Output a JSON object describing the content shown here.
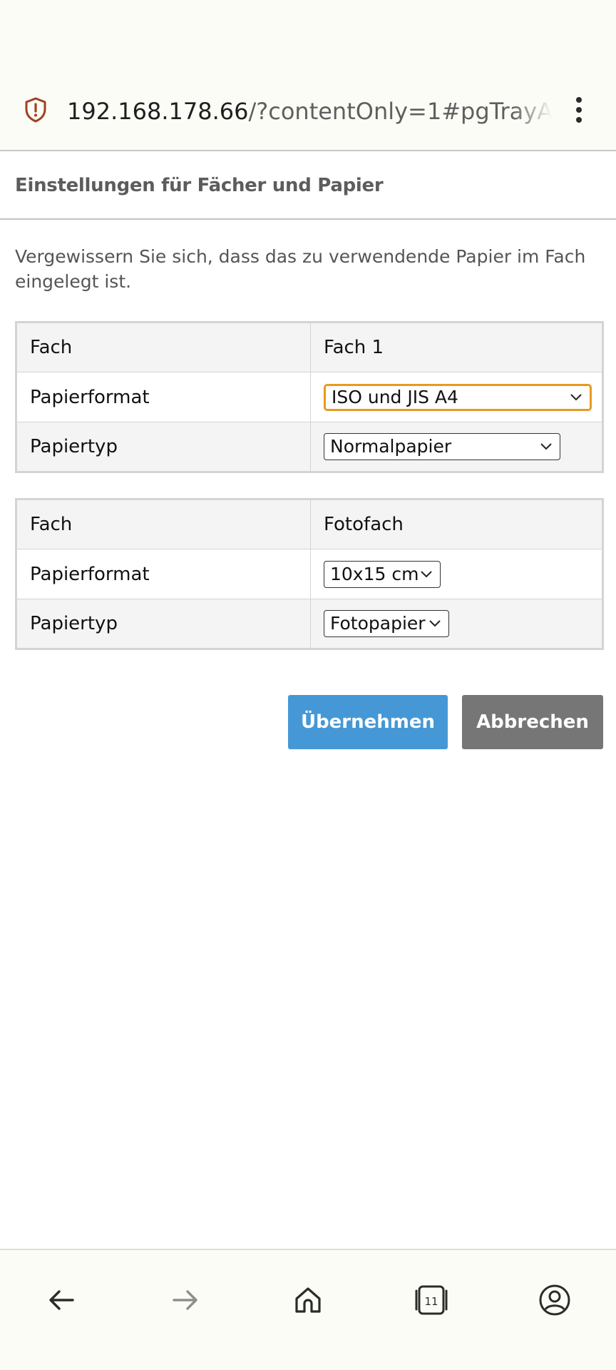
{
  "browser": {
    "url_host": "192.168.178.66",
    "url_path": "/?contentOnly=1#pgTrayAndPaper",
    "tab_count": "11"
  },
  "page": {
    "title": "Einstellungen für Fächer und Papier",
    "intro": "Vergewissern Sie sich, dass das zu verwendende Papier im Fach eingelegt ist."
  },
  "trays": [
    {
      "tray_label": "Fach",
      "tray_value": "Fach 1",
      "format_label": "Papierformat",
      "format_value": "ISO und JIS A4",
      "type_label": "Papiertyp",
      "type_value": "Normalpapier"
    },
    {
      "tray_label": "Fach",
      "tray_value": "Fotofach",
      "format_label": "Papierformat",
      "format_value": "10x15 cm",
      "type_label": "Papiertyp",
      "type_value": "Fotopapier"
    }
  ],
  "actions": {
    "apply_label": "Übernehmen",
    "cancel_label": "Abbrechen"
  },
  "colors": {
    "apply_button": "#4598d5",
    "cancel_button": "#767676",
    "focus_ring": "#e69a21",
    "shield_icon": "#a0401f"
  },
  "icons": {
    "url_bar": "shield-alert-icon",
    "menu": "more-vertical-icon",
    "nav": [
      "arrow-left-icon",
      "arrow-right-icon",
      "home-icon",
      "tabs-icon",
      "account-icon"
    ]
  }
}
